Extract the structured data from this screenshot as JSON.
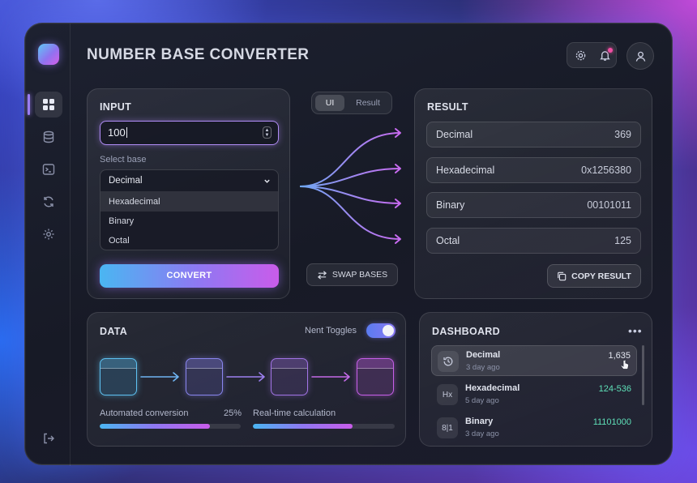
{
  "app": {
    "title": "NUMBER BASE CONVERTER"
  },
  "sidebar": {
    "items": [
      {
        "icon": "grid-icon",
        "active": true
      },
      {
        "icon": "database-icon"
      },
      {
        "icon": "terminal-icon"
      },
      {
        "icon": "refresh-icon"
      },
      {
        "icon": "gear-icon"
      }
    ],
    "logout_icon": "logout-icon"
  },
  "header": {
    "settings_icon": "gear-icon",
    "notification_icon": "bell-icon",
    "avatar_icon": "user-icon"
  },
  "input": {
    "title": "INPUT",
    "value": "100",
    "select_label": "Select base",
    "selected": "Decimal",
    "options": [
      "Hexadecimal",
      "Binary",
      "Octal"
    ],
    "convert_label": "CONVERT"
  },
  "toggle_tabs": {
    "ui": "UI",
    "result": "Result"
  },
  "swap_label": "SWAP BASES",
  "result": {
    "title": "RESULT",
    "rows": [
      {
        "name": "Decimal",
        "value": "369"
      },
      {
        "name": "Hexadecimal",
        "value": "0x1256380"
      },
      {
        "name": "Binary",
        "value": "00101011"
      },
      {
        "name": "Octal",
        "value": "125"
      }
    ],
    "copy_label": "COPY RESULT"
  },
  "data": {
    "title": "DATA",
    "toggle_label": "Nent Toggles",
    "toggle_on": true,
    "progress": [
      {
        "label": "Automated conversion",
        "value_text": "25%",
        "fill": 0.78
      },
      {
        "label": "Real-time calculation",
        "value_text": "",
        "fill": 0.7
      }
    ]
  },
  "dashboard": {
    "title": "DASHBOARD",
    "more_icon": "ellipsis-icon",
    "items": [
      {
        "icon_text": "",
        "icon": "history-icon",
        "name": "Decimal",
        "time": "3 day ago",
        "value": "1,635",
        "value_color": "#e2e5ef"
      },
      {
        "icon_text": "Hx",
        "icon": "hex-icon",
        "name": "Hexadecimal",
        "time": "5 day ago",
        "value": "124-536",
        "value_color": "#5fe0b8"
      },
      {
        "icon_text": "8|1",
        "icon": "binary-icon",
        "name": "Binary",
        "time": "3 day ago",
        "value": "11101000",
        "value_color": "#5fe0b8"
      }
    ]
  },
  "colors": {
    "accent_start": "#4ab6f2",
    "accent_mid": "#8f78f2",
    "accent_end": "#c95cea",
    "positive": "#5fe0b8"
  }
}
